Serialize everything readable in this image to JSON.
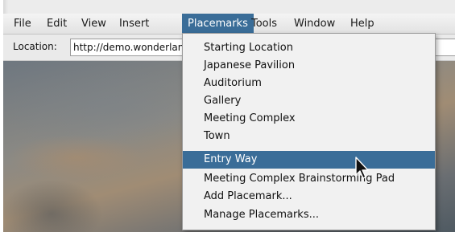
{
  "menubar": {
    "items": [
      {
        "label": "File"
      },
      {
        "label": "Edit"
      },
      {
        "label": "View"
      },
      {
        "label": "Insert"
      },
      {
        "label": "Placemarks"
      },
      {
        "label": "Tools"
      },
      {
        "label": "Window"
      },
      {
        "label": "Help"
      }
    ],
    "active": "Placemarks"
  },
  "location": {
    "label": "Location:",
    "value": "http://demo.wonderland"
  },
  "placemarks_menu": {
    "items": [
      {
        "label": "Starting Location"
      },
      {
        "label": "Japanese Pavilion"
      },
      {
        "label": "Auditorium"
      },
      {
        "label": "Gallery"
      },
      {
        "label": "Meeting Complex"
      },
      {
        "label": "Town"
      },
      {
        "label": "Entry Way"
      },
      {
        "label": "Meeting Complex Brainstorming Pad"
      },
      {
        "label": "Add Placemark..."
      },
      {
        "label": "Manage Placemarks..."
      }
    ],
    "selected": "Entry Way"
  },
  "colors": {
    "selection": "#3a6d98",
    "menu_background": "#f1f1f1"
  },
  "icons": {
    "cursor": "mouse-pointer-icon"
  }
}
